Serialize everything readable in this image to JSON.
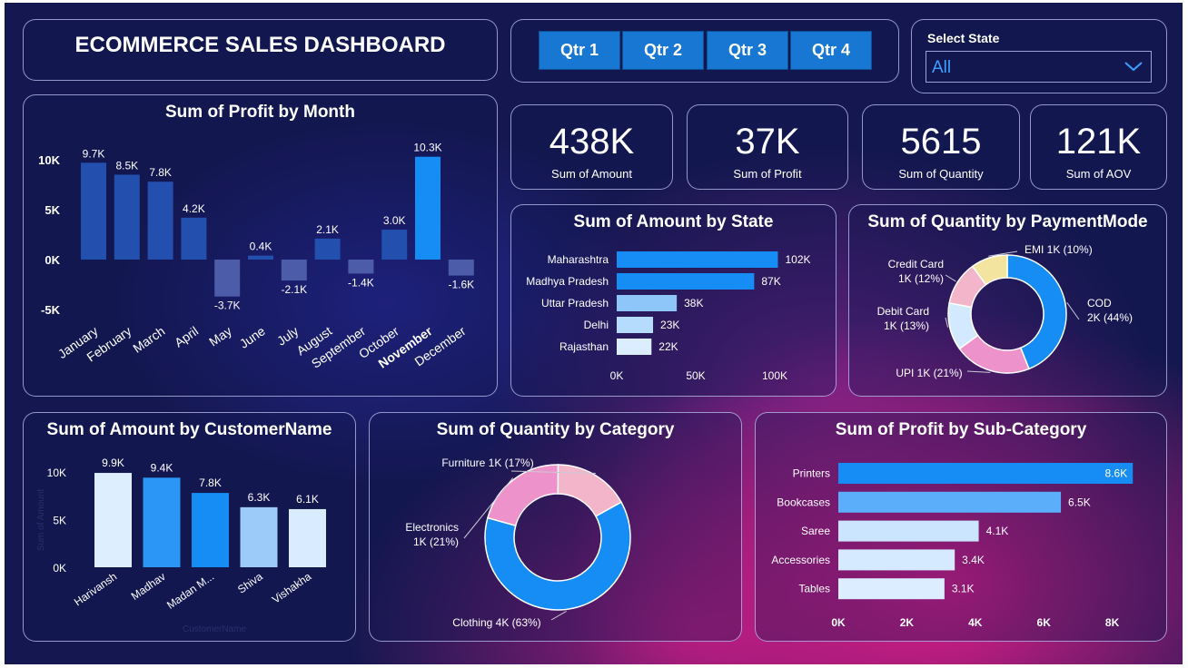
{
  "title": "ECOMMERCE SALES DASHBOARD",
  "quarters": [
    "Qtr 1",
    "Qtr 2",
    "Qtr 3",
    "Qtr 4"
  ],
  "state_filter": {
    "label": "Select State",
    "value": "All"
  },
  "kpis": [
    {
      "value": "438K",
      "label": "Sum of Amount"
    },
    {
      "value": "37K",
      "label": "Sum of Profit"
    },
    {
      "value": "5615",
      "label": "Sum of Quantity"
    },
    {
      "value": "121K",
      "label": "Sum of AOV"
    }
  ],
  "colors": {
    "accent": "#1877d2",
    "bar_bright": "#168cf5",
    "background": "#151850",
    "pink": "#e91e8c"
  },
  "chart_data": [
    {
      "id": "profit_by_month",
      "type": "bar",
      "title": "Sum of Profit by Month",
      "categories": [
        "January",
        "February",
        "March",
        "April",
        "May",
        "June",
        "July",
        "August",
        "September",
        "October",
        "November",
        "December"
      ],
      "values": [
        9.7,
        8.5,
        7.8,
        4.2,
        -3.7,
        0.4,
        -2.1,
        2.1,
        -1.4,
        3.0,
        10.3,
        -1.6
      ],
      "data_labels": [
        "9.7K",
        "8.5K",
        "7.8K",
        "4.2K",
        "-3.7K",
        "0.4K",
        "-2.1K",
        "2.1K",
        "-1.4K",
        "3.0K",
        "10.3K",
        "-1.6K"
      ],
      "yticks": [
        "10K",
        "5K",
        "0K",
        "-5K"
      ],
      "ylim": [
        -5,
        10
      ],
      "highlight": "November",
      "xlabel": "",
      "ylabel": ""
    },
    {
      "id": "amount_by_state",
      "type": "bar",
      "orientation": "horizontal",
      "title": "Sum of Amount by State",
      "categories": [
        "Maharashtra",
        "Madhya Pradesh",
        "Uttar Pradesh",
        "Delhi",
        "Rajasthan"
      ],
      "values": [
        102,
        87,
        38,
        23,
        22
      ],
      "data_labels": [
        "102K",
        "87K",
        "38K",
        "23K",
        "22K"
      ],
      "xticks": [
        "0K",
        "50K",
        "100K"
      ],
      "xlim": [
        0,
        100
      ]
    },
    {
      "id": "quantity_by_paymentmode",
      "type": "pie",
      "donut": true,
      "title": "Sum of Quantity by PaymentMode",
      "categories": [
        "COD",
        "UPI",
        "Debit Card",
        "Credit Card",
        "EMI"
      ],
      "values": [
        44,
        21,
        13,
        12,
        10
      ],
      "labels": [
        [
          "COD",
          "2K (44%)"
        ],
        [
          "UPI 1K (21%)"
        ],
        [
          "Debit Card",
          "1K (13%)"
        ],
        [
          "Credit Card",
          "1K (12%)"
        ],
        [
          "EMI 1K (10%)"
        ]
      ],
      "colors": [
        "#168cf5",
        "#ee92cc",
        "#d2e9ff",
        "#f2b5c9",
        "#f3e5a0"
      ]
    },
    {
      "id": "amount_by_customer",
      "type": "bar",
      "title": "Sum of Amount by CustomerName",
      "categories": [
        "Harivansh",
        "Madhav",
        "Madan M...",
        "Shiva",
        "Vishakha"
      ],
      "values": [
        9.9,
        9.4,
        7.8,
        6.3,
        6.1
      ],
      "data_labels": [
        "9.9K",
        "9.4K",
        "7.8K",
        "6.3K",
        "6.1K"
      ],
      "yticks": [
        "10K",
        "5K",
        "0K"
      ],
      "ylim": [
        0,
        10
      ],
      "xlabel": "CustomerName",
      "ylabel": "Sum of Amount",
      "colors": [
        "#ddeeff",
        "#2b96f5",
        "#168cf5",
        "#9ccaf9",
        "#d9ecff"
      ]
    },
    {
      "id": "quantity_by_category",
      "type": "pie",
      "donut": true,
      "title": "Sum of Quantity by Category",
      "categories": [
        "Clothing",
        "Electronics",
        "Furniture"
      ],
      "values": [
        63,
        21,
        17
      ],
      "labels": [
        [
          "Clothing 4K (63%)"
        ],
        [
          "Electronics",
          "1K (21%)"
        ],
        [
          "Furniture 1K (17%)"
        ]
      ],
      "colors": [
        "#168cf5",
        "#ee92cc",
        "#f2b5c9"
      ]
    },
    {
      "id": "profit_by_subcategory",
      "type": "bar",
      "orientation": "horizontal",
      "title": "Sum of Profit by Sub-Category",
      "categories": [
        "Printers",
        "Bookcases",
        "Saree",
        "Accessories",
        "Tables"
      ],
      "values": [
        8.6,
        6.5,
        4.1,
        3.4,
        3.1
      ],
      "data_labels": [
        "8.6K",
        "6.5K",
        "4.1K",
        "3.4K",
        "3.1K"
      ],
      "xticks": [
        "0K",
        "2K",
        "4K",
        "6K",
        "8K"
      ],
      "xlim": [
        0,
        8
      ],
      "colors": [
        "#168cf5",
        "#5aaefa",
        "#cce5ff",
        "#d6eaff",
        "#dbedff"
      ]
    }
  ]
}
